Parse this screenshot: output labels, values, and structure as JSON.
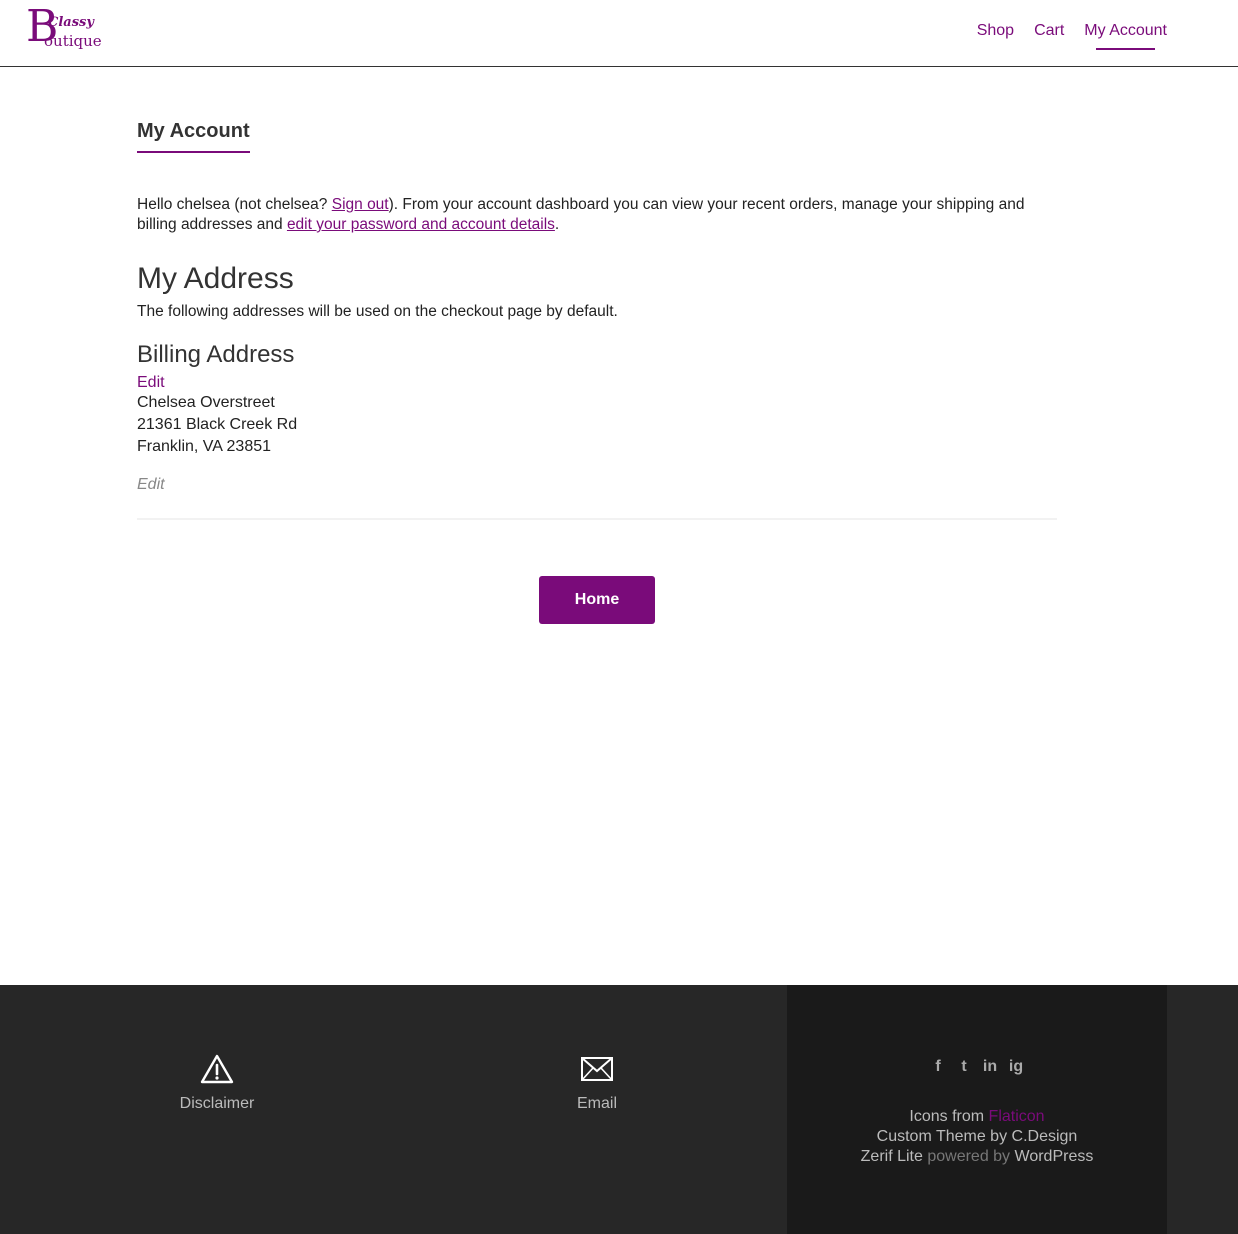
{
  "header": {
    "logo_big": "B",
    "logo_top": "Classy",
    "logo_bottom": "outique",
    "nav": [
      "Shop",
      "Cart",
      "My Account"
    ]
  },
  "main": {
    "page_title": "My Account",
    "intro": {
      "hello": "Hello chelsea (not chelsea? ",
      "sign_out": "Sign out",
      "middle": "). From your account dashboard you can view your recent orders, manage your shipping and billing addresses and ",
      "edit_link": "edit your password and account details",
      "end": "."
    },
    "address_heading": "My Address",
    "address_note": "The following addresses will be used on the checkout page by default.",
    "billing_heading": "Billing Address",
    "edit_label": "Edit",
    "billing_lines": [
      "Chelsea Overstreet",
      "21361 Black Creek Rd",
      "Franklin, VA 23851"
    ],
    "edit_italic_label": "Edit",
    "home_button": "Home"
  },
  "footer": {
    "disclaimer_label": "Disclaimer",
    "email_label": "Email",
    "social": [
      "f",
      "t",
      "in",
      "ig"
    ],
    "credits": {
      "icons_from": "Icons from ",
      "flaticon": "Flaticon",
      "custom_theme": "Custom Theme by C.Design",
      "zerif": "Zerif Lite",
      "powered_by": " powered by ",
      "wordpress": "WordPress"
    }
  },
  "colors": {
    "accent": "#7a0b7a",
    "footer_bg": "#272727",
    "footer_dark_bg": "#1a1a1a"
  }
}
